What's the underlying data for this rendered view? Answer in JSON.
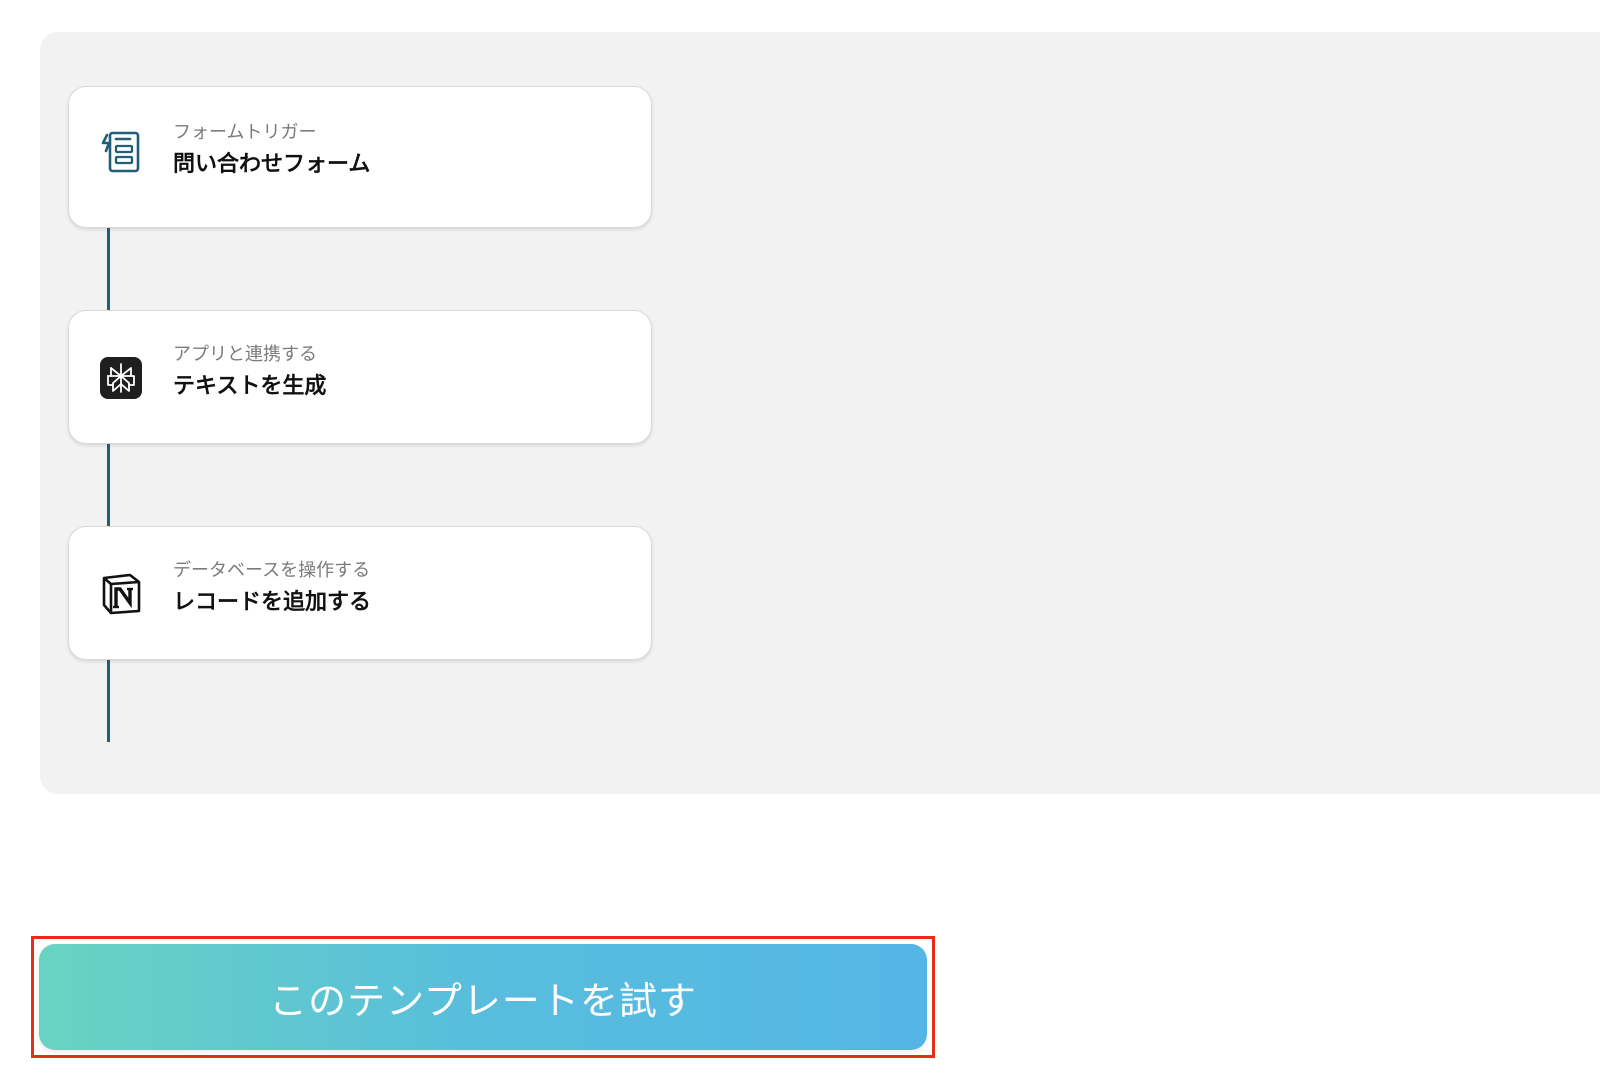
{
  "steps": [
    {
      "subtitle": "フォームトリガー",
      "title": "問い合わせフォーム",
      "icon": "form-trigger-icon",
      "icon_color": "#1f5f77"
    },
    {
      "subtitle": "アプリと連携する",
      "title": "テキストを生成",
      "icon": "perplexity-icon",
      "icon_color": "#1f1f1f"
    },
    {
      "subtitle": "データベースを操作する",
      "title": "レコードを追加する",
      "icon": "notion-icon",
      "icon_color": "#111111"
    }
  ],
  "cta": {
    "label": "このテンプレートを試す",
    "gradient_start": "#69d3c2",
    "gradient_end": "#55b6e6",
    "highlight_border": "#e52d17"
  },
  "colors": {
    "panel_background": "#f2f2f2",
    "connector": "#1f5f77"
  }
}
